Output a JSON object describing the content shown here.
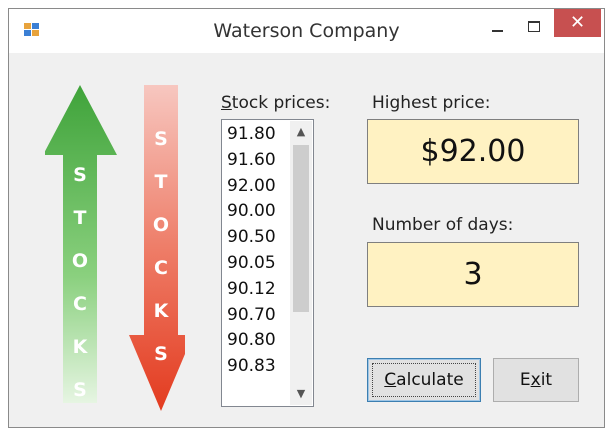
{
  "window": {
    "title": "Waterson Company",
    "close_glyph": "✕"
  },
  "arrows": {
    "up_label": "STOCKS",
    "down_label": "STOCKS",
    "up_color": "#4caf50",
    "down_color": "#e53935"
  },
  "stock_prices": {
    "label_accel": "S",
    "label_rest": "tock prices:",
    "items": [
      "91.80",
      "91.60",
      "92.00",
      "90.00",
      "90.50",
      "90.05",
      "90.12",
      "90.70",
      "90.80",
      "90.83"
    ]
  },
  "highest_price": {
    "label": "Highest price:",
    "value": "$92.00"
  },
  "number_of_days": {
    "label": "Number of days:",
    "value": "3"
  },
  "buttons": {
    "calculate_accel": "C",
    "calculate_rest": "alculate",
    "exit_pre": "E",
    "exit_accel": "x",
    "exit_rest": "it"
  },
  "colors": {
    "output_bg": "#fff2c2",
    "close_bg": "#c75050"
  }
}
